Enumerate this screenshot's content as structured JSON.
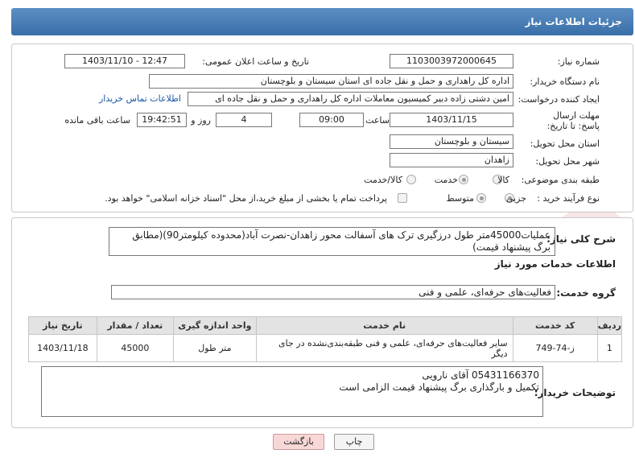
{
  "header": {
    "title": "جزئیات اطلاعات نیاز"
  },
  "form": {
    "need_number_label": "شماره نیاز:",
    "need_number": "1103003972000645",
    "announce_label": "تاریخ و ساعت اعلان عمومی:",
    "announce_value": "1403/11/10 - 12:47",
    "buyer_org_label": "نام دستگاه خریدار:",
    "buyer_org": "اداره کل راهداری و حمل و نقل جاده ای استان سیستان و بلوچستان",
    "requester_label": "ایجاد کننده درخواست:",
    "requester": "امین دشتی زاده دبیر کمیسیون معاملات اداره کل راهداری و حمل و نقل جاده ای",
    "contact_link": "اطلاعات تماس خریدار",
    "deadline_label": "مهلت ارسال پاسخ: تا تاریخ:",
    "deadline_date": "1403/11/15",
    "time_label": "ساعت",
    "deadline_time": "09:00",
    "days_value": "4",
    "days_label": "روز و",
    "remaining_time": "19:42:51",
    "remaining_label": "ساعت باقی مانده",
    "province_label": "استان محل تحویل:",
    "province": "سیستان و بلوچستان",
    "city_label": "شهر محل تحویل:",
    "city": "زاهدان",
    "category_label": "طبقه بندی موضوعی:",
    "category_options": [
      "کالا",
      "خدمت",
      "کالا/خدمت"
    ],
    "category_selected": "خدمت",
    "process_label": "نوع فرآیند خرید :",
    "process_options": [
      "جزیی",
      "متوسط"
    ],
    "process_selected": "جزیی",
    "payment_note": "پرداخت تمام یا بخشی از مبلغ خرید،از محل \"اسناد خزانه اسلامی\" خواهد بود."
  },
  "summary": {
    "label": "شرح کلی نیاز:",
    "text": "عملیات45000متر طول درزگیری ترک های آسفالت محور زاهدان-نصرت آباد(محدوده کیلومتر90)(مطابق برگ پیشنهاد قیمت)"
  },
  "services": {
    "section_title": "اطلاعات خدمات مورد نیاز",
    "group_label": "گروه خدمت:",
    "group_value": "فعالیت‌های حرفه‌ای، علمی و فنی",
    "columns": [
      "ردیف",
      "کد خدمت",
      "نام خدمت",
      "واحد اندازه گیری",
      "تعداد / مقدار",
      "تاریخ نیاز"
    ],
    "rows": [
      {
        "idx": "1",
        "code": "ز-74-749",
        "name": "سایر فعالیت‌های حرفه‌ای، علمی و فنی طبقه‌بندی‌نشده در جای دیگر",
        "unit": "متر طول",
        "qty": "45000",
        "date": "1403/11/18"
      }
    ]
  },
  "buyer_notes": {
    "label": "توضیحات خریدار:",
    "line1": "05431166370 آقای نارویی",
    "line2": "تکمیل و بارگذاری برگ پیشنهاد قیمت الزامی است"
  },
  "buttons": {
    "print": "چاپ",
    "back": "بازگشت"
  },
  "watermark": {
    "text": "AriaTender.neT"
  },
  "colors": {
    "header": "#3a6ea7",
    "link": "#1a57a8",
    "back_btn": "#f8d7d7",
    "print_btn": "#f4f4f4"
  }
}
